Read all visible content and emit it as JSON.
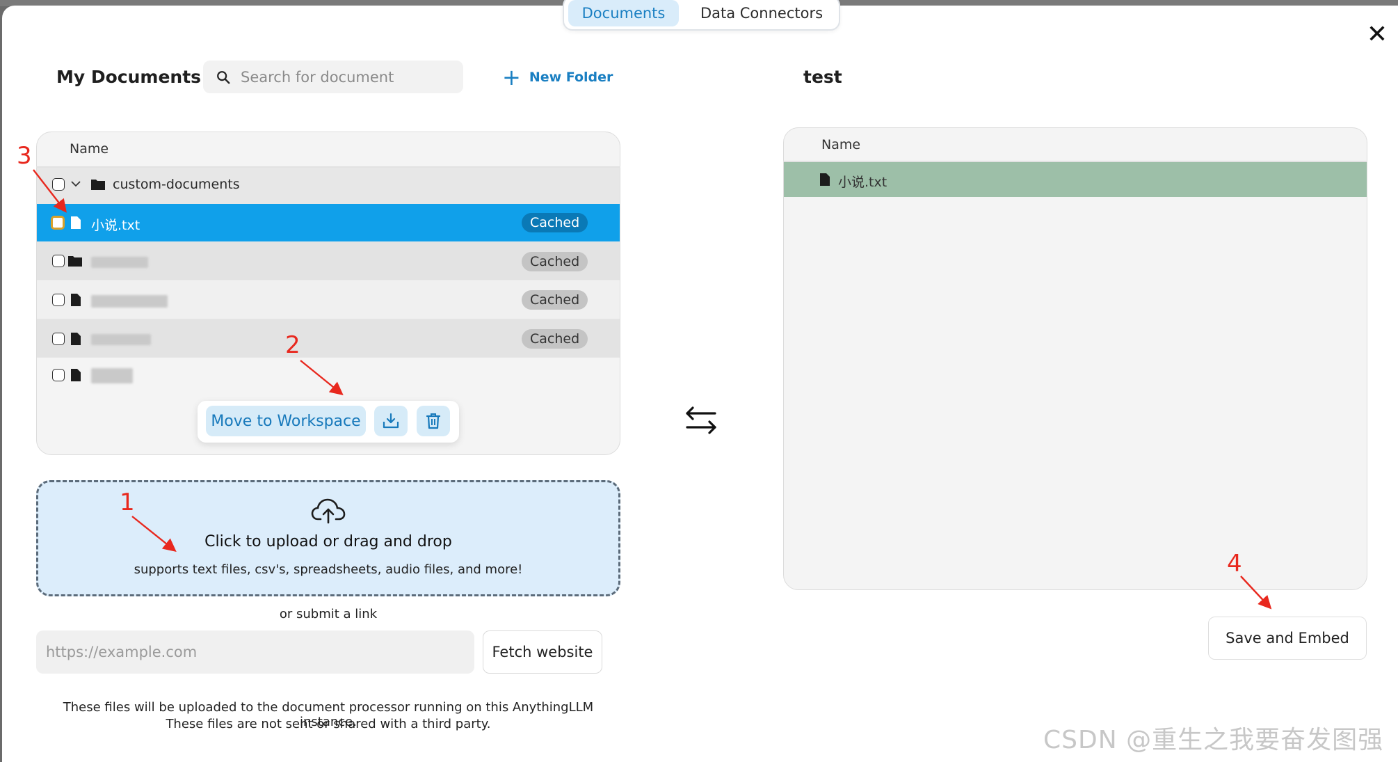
{
  "tabs": [
    {
      "label": "Documents",
      "active": true
    },
    {
      "label": "Data Connectors",
      "active": false
    }
  ],
  "close_glyph": "✕",
  "left": {
    "title": "My Documents",
    "search_placeholder": "Search for document",
    "new_folder_label": "New Folder",
    "column_name": "Name",
    "folder": {
      "name": "custom-documents",
      "icon": "folder-icon"
    },
    "rows": [
      {
        "name": "小说.txt",
        "badge": "Cached",
        "selected": true
      },
      {
        "name": "",
        "badge": "Cached",
        "selected": false
      },
      {
        "name": "",
        "badge": "Cached",
        "selected": false
      },
      {
        "name": "",
        "badge": "Cached",
        "selected": false
      },
      {
        "name": "",
        "badge": "",
        "selected": false
      }
    ],
    "toolbar": {
      "move_label": "Move to Workspace",
      "embed_icon": "tray-download-icon",
      "delete_icon": "trash-icon"
    },
    "upload": {
      "title": "Click to upload or drag and drop",
      "subtitle": "supports text files, csv's, spreadsheets, audio files, and more!"
    },
    "or_link": "or submit a link",
    "url_placeholder": "https://example.com",
    "fetch_label": "Fetch website",
    "footer_line1": "These files will be uploaded to the document processor running on this AnythingLLM instance.",
    "footer_line2": "These files are not sent or shared with a third party."
  },
  "right": {
    "title": "test",
    "column_name": "Name",
    "files": [
      {
        "name": "小说.txt"
      }
    ],
    "save_label": "Save and Embed"
  },
  "annotations": [
    "1",
    "2",
    "3",
    "4"
  ],
  "annotation_color": "#e8281e",
  "accent_color": "#10a0ea",
  "watermark": "CSDN @重生之我要奋发图强"
}
